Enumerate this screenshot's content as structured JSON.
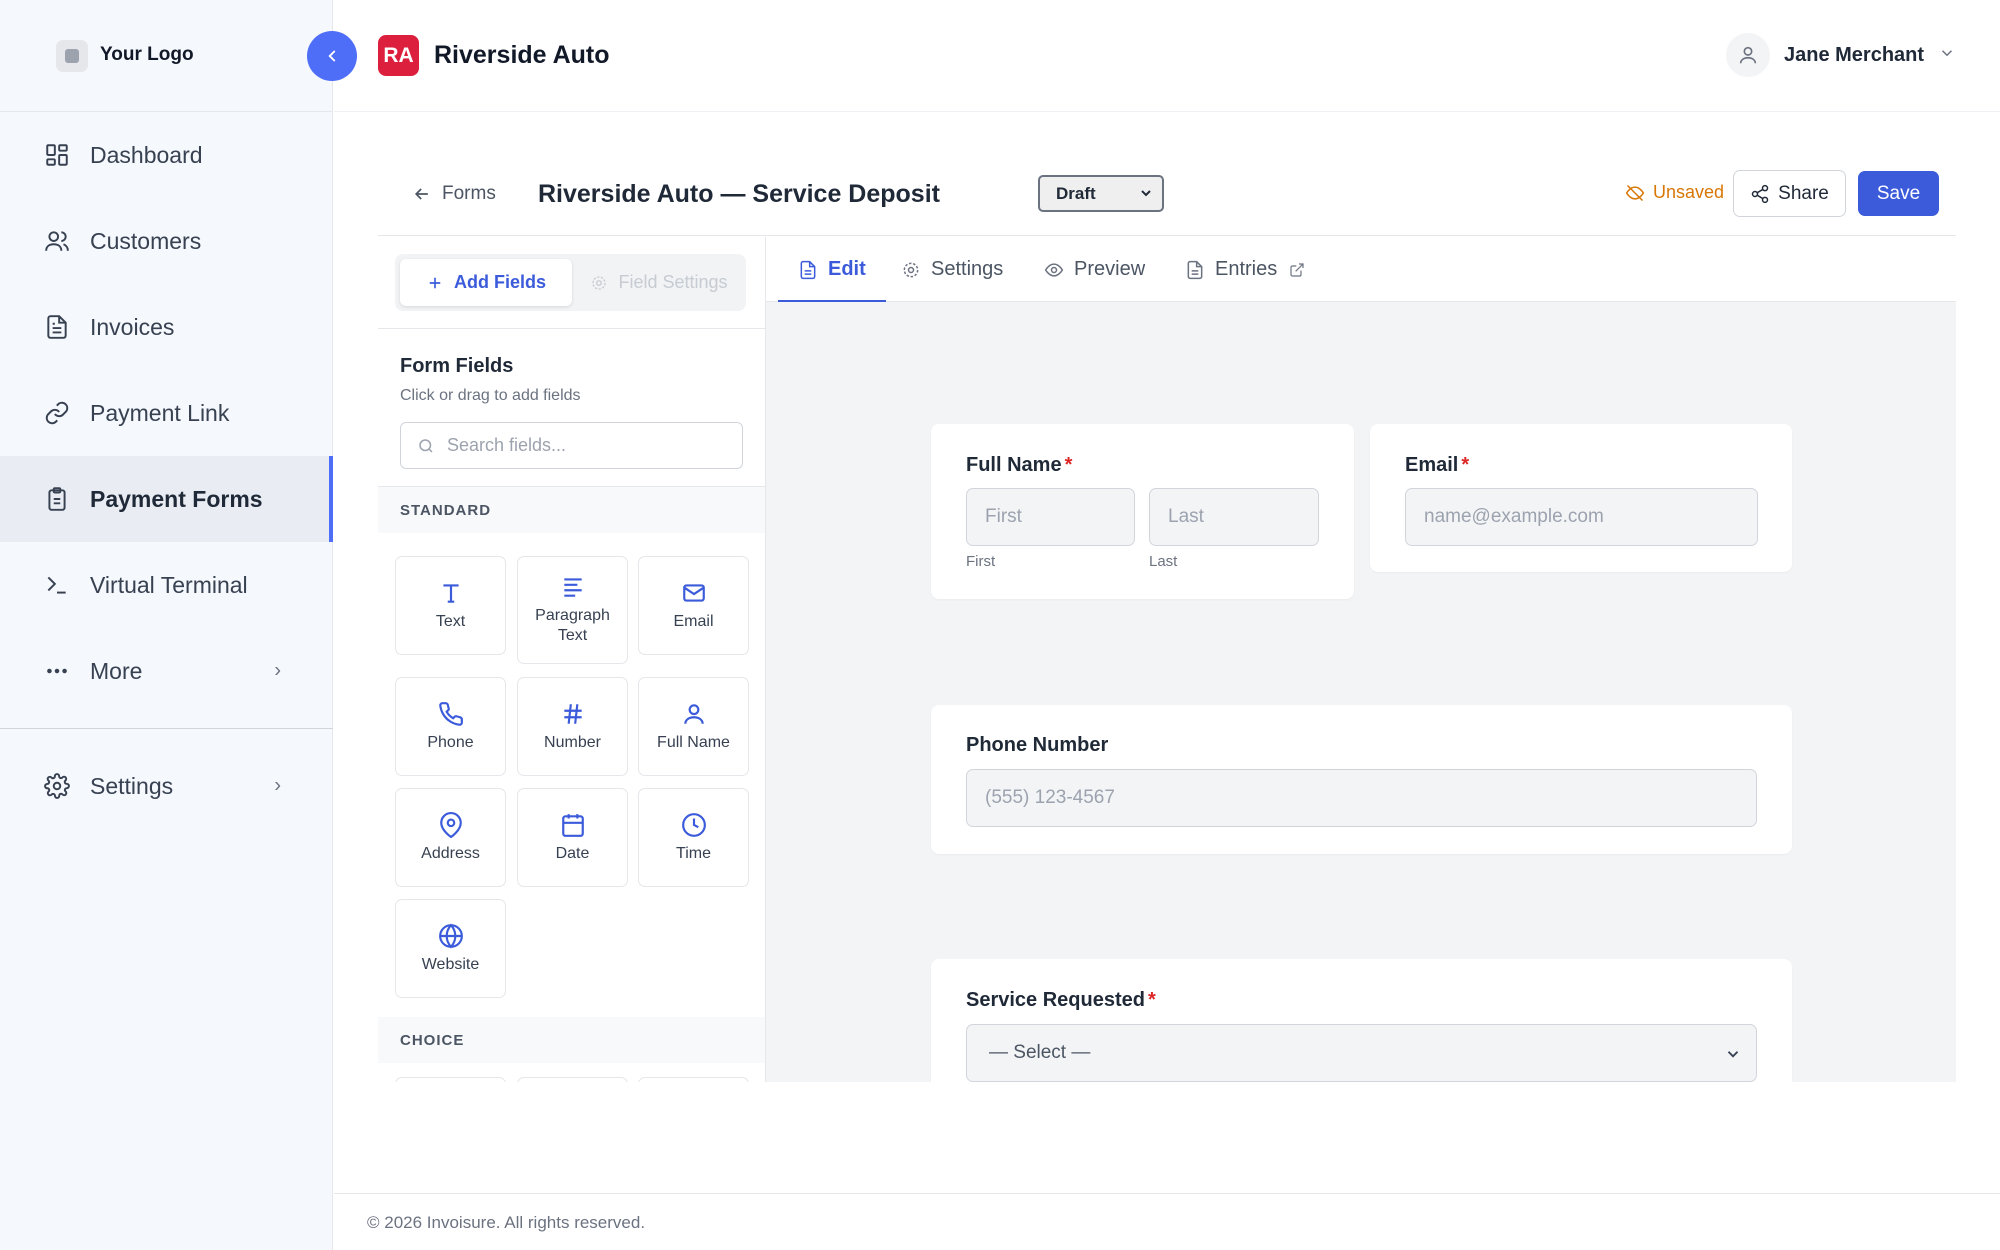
{
  "sidebar": {
    "logo_text": "Your Logo",
    "items": [
      {
        "label": "Dashboard",
        "icon": "dashboard-icon"
      },
      {
        "label": "Customers",
        "icon": "users-icon"
      },
      {
        "label": "Invoices",
        "icon": "document-icon"
      },
      {
        "label": "Payment Link",
        "icon": "link-icon"
      },
      {
        "label": "Payment Forms",
        "icon": "clipboard-icon",
        "active": true
      },
      {
        "label": "Virtual Terminal",
        "icon": "terminal-icon"
      },
      {
        "label": "More",
        "icon": "more-icon"
      }
    ],
    "settings_label": "Settings"
  },
  "header": {
    "badge": "RA",
    "business_name": "Riverside Auto",
    "user_name": "Jane Merchant"
  },
  "toolbar": {
    "back_label": "Forms",
    "form_title": "Riverside Auto — Service Deposit",
    "status_value": "Draft",
    "unsaved_label": "Unsaved",
    "share_label": "Share",
    "save_label": "Save"
  },
  "left_panel": {
    "add_fields_label": "Add Fields",
    "field_settings_label": "Field Settings",
    "title": "Form Fields",
    "subtitle": "Click or drag to add fields",
    "search_placeholder": "Search fields...",
    "standard_header": "STANDARD",
    "choice_header": "CHOICE",
    "tiles": [
      {
        "label": "Text",
        "icon": "text-icon"
      },
      {
        "label": "Paragraph Text",
        "icon": "paragraph-icon"
      },
      {
        "label": "Email",
        "icon": "email-icon"
      },
      {
        "label": "Phone",
        "icon": "phone-icon"
      },
      {
        "label": "Number",
        "icon": "hash-icon"
      },
      {
        "label": "Full Name",
        "icon": "person-icon"
      },
      {
        "label": "Address",
        "icon": "map-pin-icon"
      },
      {
        "label": "Date",
        "icon": "calendar-icon"
      },
      {
        "label": "Time",
        "icon": "clock-icon"
      },
      {
        "label": "Website",
        "icon": "globe-icon"
      }
    ]
  },
  "tabs": [
    {
      "label": "Edit",
      "active": true
    },
    {
      "label": "Settings"
    },
    {
      "label": "Preview"
    },
    {
      "label": "Entries"
    }
  ],
  "form": {
    "full_name_label": "Full Name",
    "first_placeholder": "First",
    "last_placeholder": "Last",
    "first_caption": "First",
    "last_caption": "Last",
    "email_label": "Email",
    "email_placeholder": "name@example.com",
    "phone_label": "Phone Number",
    "phone_placeholder": "(555) 123-4567",
    "service_label": "Service Requested",
    "service_value": "— Select —",
    "required_mark": "*"
  },
  "footer": {
    "copyright": "© 2026 Invoisure. All rights reserved."
  },
  "colors": {
    "accent": "#3b5bdb",
    "brand_badge": "#dc1f3c",
    "warning": "#d97706",
    "required": "#dc2626"
  }
}
